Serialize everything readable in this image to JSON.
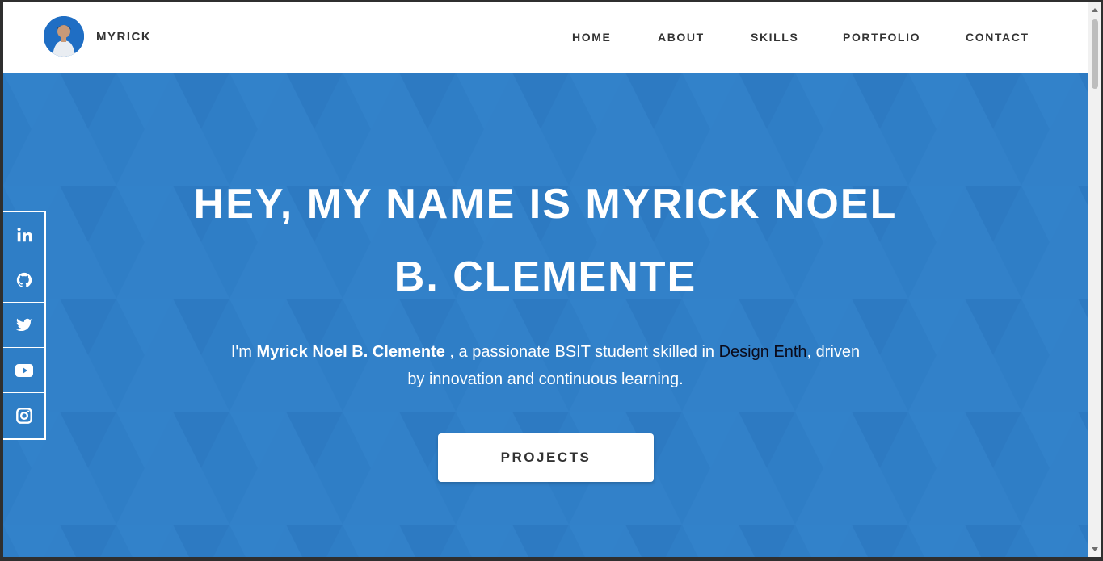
{
  "brand": {
    "name": "MYRICK"
  },
  "nav": [
    {
      "label": "HOME"
    },
    {
      "label": "ABOUT"
    },
    {
      "label": "SKILLS"
    },
    {
      "label": "PORTFOLIO"
    },
    {
      "label": "CONTACT"
    }
  ],
  "hero": {
    "title_line1": "HEY, MY NAME IS MYRICK NOEL",
    "title_line2": "B. CLEMENTE",
    "intro_prefix": "I'm ",
    "intro_name": "Myrick Noel B. Clemente",
    "intro_middle": " , a passionate BSIT student skilled in ",
    "intro_skill": "Design Enth",
    "intro_suffix": ", driven",
    "intro_line2": "by innovation and continuous learning.",
    "button_label": "PROJECTS"
  },
  "social": [
    {
      "icon": "linkedin-icon"
    },
    {
      "icon": "github-icon"
    },
    {
      "icon": "twitter-icon"
    },
    {
      "icon": "youtube-icon"
    },
    {
      "icon": "instagram-icon"
    }
  ],
  "colors": {
    "hero_bg": "#2f7ec6",
    "header_bg": "#ffffff",
    "text_dark": "#333333",
    "highlight": "#0a0a1a"
  }
}
